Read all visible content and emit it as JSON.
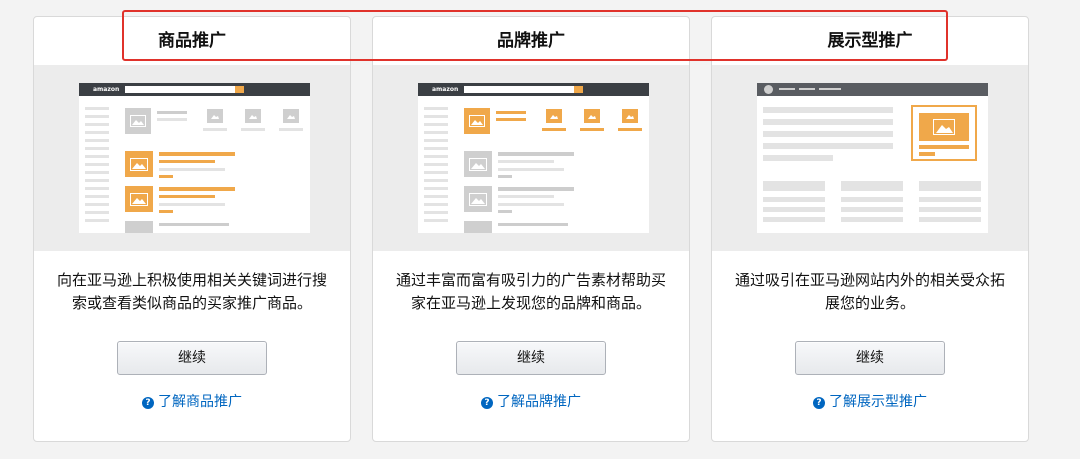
{
  "cards": [
    {
      "title": "商品推广",
      "description": "向在亚马逊上积极使用相关关键词进行搜索或查看类似商品的买家推广商品。",
      "button": "继续",
      "link": "了解商品推广"
    },
    {
      "title": "品牌推广",
      "description": "通过丰富而富有吸引力的广告素材帮助买家在亚马逊上发现您的品牌和商品。",
      "button": "继续",
      "link": "了解品牌推广"
    },
    {
      "title": "展示型推广",
      "description": "通过吸引在亚马逊网站内外的相关受众拓展您的业务。",
      "button": "继续",
      "link": "了解展示型推广"
    }
  ],
  "mockup": {
    "logo": "amazon"
  },
  "icons": {
    "help": "question-circle-icon",
    "image": "image-placeholder-icon"
  },
  "colors": {
    "accent": "#f0a84a",
    "link": "#0066c0",
    "highlight": "#e0322b"
  }
}
